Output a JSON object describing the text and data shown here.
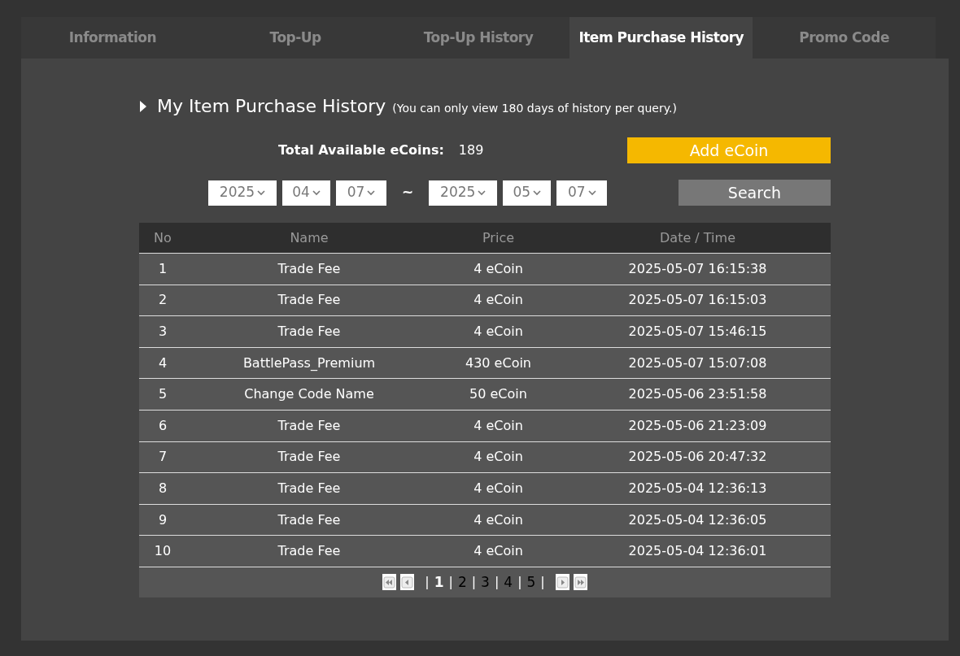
{
  "tabs": [
    {
      "label": "Information",
      "selected": false
    },
    {
      "label": "Top-Up",
      "selected": false
    },
    {
      "label": "Top-Up History",
      "selected": false
    },
    {
      "label": "Item Purchase History",
      "selected": true
    },
    {
      "label": "Promo Code",
      "selected": false
    }
  ],
  "heading": {
    "title": "My Item Purchase History",
    "note": "(You can only view 180 days of history per query.)"
  },
  "balance": {
    "label": "Total Available eCoins:",
    "value": "189"
  },
  "add_button": "Add eCoin",
  "date_range": {
    "from": [
      "2025",
      "04",
      "07"
    ],
    "separator": "~",
    "to": [
      "2025",
      "05",
      "07"
    ]
  },
  "search_button": "Search",
  "table": {
    "columns": [
      "No",
      "Name",
      "Price",
      "Date / Time"
    ],
    "rows": [
      [
        "1",
        "Trade Fee",
        "4 eCoin",
        "2025-05-07 16:15:38"
      ],
      [
        "2",
        "Trade Fee",
        "4 eCoin",
        "2025-05-07 16:15:03"
      ],
      [
        "3",
        "Trade Fee",
        "4 eCoin",
        "2025-05-07 15:46:15"
      ],
      [
        "4",
        "BattlePass_Premium",
        "430 eCoin",
        "2025-05-07 15:07:08"
      ],
      [
        "5",
        "Change Code Name",
        "50 eCoin",
        "2025-05-06 23:51:58"
      ],
      [
        "6",
        "Trade Fee",
        "4 eCoin",
        "2025-05-06 21:23:09"
      ],
      [
        "7",
        "Trade Fee",
        "4 eCoin",
        "2025-05-06 20:47:32"
      ],
      [
        "8",
        "Trade Fee",
        "4 eCoin",
        "2025-05-04 12:36:13"
      ],
      [
        "9",
        "Trade Fee",
        "4 eCoin",
        "2025-05-04 12:36:05"
      ],
      [
        "10",
        "Trade Fee",
        "4 eCoin",
        "2025-05-04 12:36:01"
      ]
    ]
  },
  "pagination": {
    "pages": [
      {
        "label": "1",
        "selected": true
      },
      {
        "label": "2",
        "selected": false
      },
      {
        "label": "3",
        "selected": false
      },
      {
        "label": "4",
        "selected": false
      },
      {
        "label": "5",
        "selected": false
      }
    ],
    "separators": [
      "|",
      "|",
      "|",
      "|",
      "|",
      "|"
    ]
  }
}
